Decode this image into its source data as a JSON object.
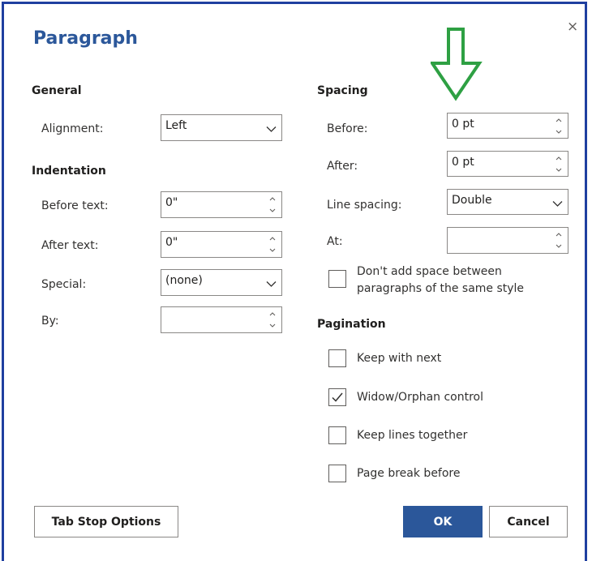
{
  "dialog": {
    "title": "Paragraph",
    "close_glyph": "×"
  },
  "general": {
    "heading": "General",
    "alignment_label": "Alignment:",
    "alignment_value": "Left"
  },
  "indentation": {
    "heading": "Indentation",
    "before_text_label": "Before text:",
    "before_text_value": "0\"",
    "after_text_label": "After text:",
    "after_text_value": "0\"",
    "special_label": "Special:",
    "special_value": "(none)",
    "by_label": "By:",
    "by_value": ""
  },
  "spacing": {
    "heading": "Spacing",
    "before_label": "Before:",
    "before_value": "0 pt",
    "after_label": "After:",
    "after_value": "0 pt",
    "line_spacing_label": "Line spacing:",
    "line_spacing_value": "Double",
    "at_label": "At:",
    "at_value": "",
    "no_space_line1": "Don't add space between",
    "no_space_line2": "paragraphs of the same style",
    "no_space_checked": false
  },
  "pagination": {
    "heading": "Pagination",
    "keep_with_next": "Keep with next",
    "keep_with_next_checked": false,
    "widow_orphan": "Widow/Orphan control",
    "widow_orphan_checked": true,
    "keep_lines_together": "Keep lines together",
    "keep_lines_together_checked": false,
    "page_break_before": "Page break before",
    "page_break_before_checked": false
  },
  "buttons": {
    "tab_stop_options": "Tab Stop Options",
    "ok": "OK",
    "cancel": "Cancel"
  },
  "annotation": {
    "arrow_color": "#2ea043",
    "arrow_icon": "arrow-down-outline-icon"
  },
  "colors": {
    "accent": "#2b579a",
    "frame": "#1f3fa0",
    "border": "#8a8886"
  }
}
